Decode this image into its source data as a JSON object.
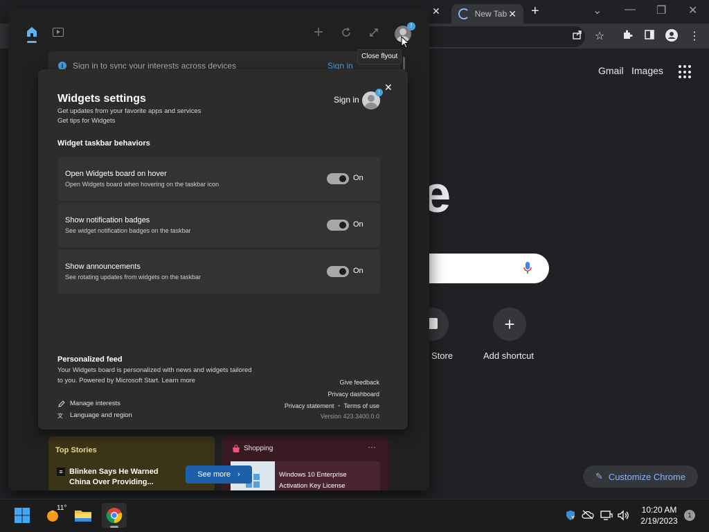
{
  "chrome": {
    "active_tab_title": "New Tab",
    "close_glyph": "✕",
    "new_tab_glyph": "+",
    "window_controls": {
      "dropdown": "⌄",
      "minimize": "—",
      "restore": "❐",
      "close": "✕"
    },
    "toolbar_icons": [
      "share-icon",
      "star-icon",
      "extensions-icon",
      "side-panel-icon",
      "profile-icon",
      "menu-icon"
    ],
    "ntp": {
      "gmail": "Gmail",
      "images": "Images",
      "logo_fragment": "e",
      "shortcuts": [
        {
          "label": "Store"
        },
        {
          "label": "Add shortcut",
          "glyph": "+"
        }
      ],
      "customize": "Customize Chrome"
    }
  },
  "widgets": {
    "sync_banner": {
      "text": "Sign in to sync your interests across devices",
      "action": "Sign in",
      "info_glyph": "i"
    },
    "tooltip": "Close flyout",
    "avatar_badge": "!",
    "settings": {
      "close_glyph": "✕",
      "title": "Widgets settings",
      "subtitle_1": "Get updates from your favorite apps and services",
      "subtitle_2": "Get tips for Widgets",
      "sign_in": "Sign in",
      "section_heading": "Widget taskbar behaviors",
      "rows": [
        {
          "title": "Open Widgets board on hover",
          "desc": "Open Widgets board when hovering on the taskbar icon",
          "state": "On"
        },
        {
          "title": "Show notification badges",
          "desc": "See widget notification badges on the taskbar",
          "state": "On"
        },
        {
          "title": "Show announcements",
          "desc": "See rotating updates from widgets on the taskbar",
          "state": "On"
        }
      ],
      "feed": {
        "heading": "Personalized feed",
        "desc_1": "Your Widgets board is personalized with news and widgets tailored",
        "desc_2": "to you. Powered by Microsoft Start. Learn more",
        "manage_interests": "Manage interests",
        "language_region": "Language and region"
      },
      "links": {
        "give_feedback": "Give feedback",
        "privacy_dashboard": "Privacy dashboard",
        "privacy_statement": "Privacy statement",
        "separator": "•",
        "terms": "Terms of use",
        "version": "Version 423.3400.0.0"
      }
    },
    "cards": {
      "top_stories": {
        "title": "Top Stories",
        "headline": "Blinken Says He Warned China Over Providing...",
        "source_glyph": "≡"
      },
      "shopping": {
        "title": "Shopping",
        "more": "···",
        "item": "Windows 10 Enterprise Activation Key License"
      },
      "see_more": "See more",
      "see_more_chevron": "›"
    }
  },
  "taskbar": {
    "weather_temp": "11°",
    "time": "10:20 AM",
    "date": "2/19/2023",
    "notification_count": "1",
    "tray_icons": [
      "defender-icon",
      "onedrive-icon",
      "network-icon",
      "volume-icon"
    ]
  },
  "colors": {
    "accent_blue": "#4a9fd8",
    "chrome_link_blue": "#8ab4f8",
    "see_more_blue": "#1d5fa8"
  }
}
